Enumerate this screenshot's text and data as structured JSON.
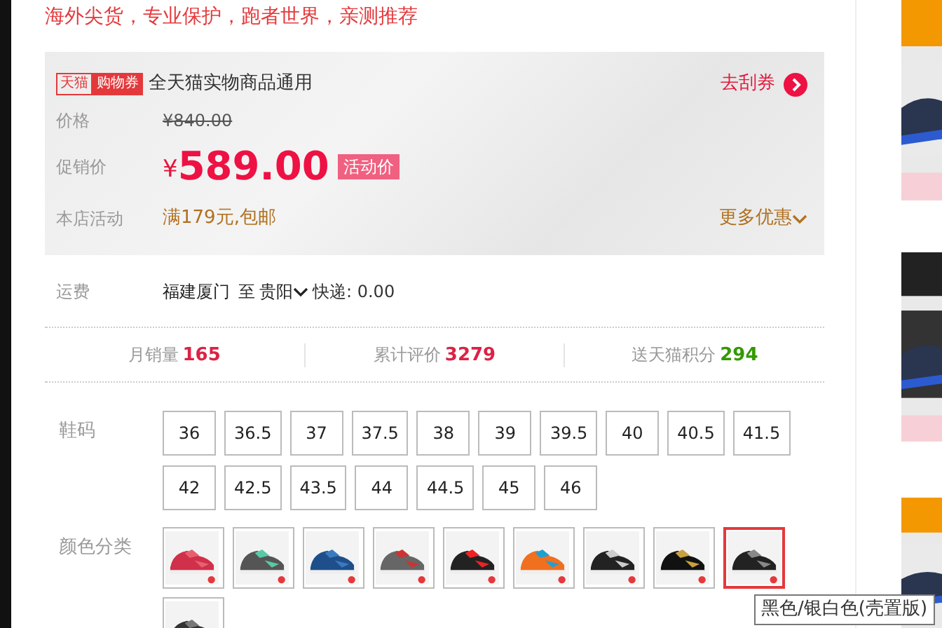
{
  "slogan": "海外尖货，专业保护，跑者世界，亲测推荐",
  "coupon": {
    "brand_tag": "天猫",
    "tag": "购物券",
    "text": "全天猫实物商品通用",
    "link": "去刮券"
  },
  "price": {
    "label": "价格",
    "original": "¥840.00"
  },
  "promo": {
    "label": "促销价",
    "currency": "¥",
    "amount": "589.00",
    "badge": "活动价"
  },
  "activity": {
    "label": "本店活动",
    "text": "满179元,包邮",
    "more": "更多优惠"
  },
  "shipping": {
    "label": "运费",
    "from": "福建厦门",
    "to_word": "至",
    "to": "贵阳",
    "method": "快递: 0.00"
  },
  "stats": [
    {
      "label": "月销量",
      "value": "165",
      "color": "#dd2244"
    },
    {
      "label": "累计评价",
      "value": "3279",
      "color": "#dd2244"
    },
    {
      "label": "送天猫积分",
      "value": "294",
      "color": "#339900"
    }
  ],
  "sizes": {
    "label": "鞋码",
    "items": [
      {
        "label": "36",
        "selected": false
      },
      {
        "label": "36.5",
        "selected": false
      },
      {
        "label": "37",
        "selected": false
      },
      {
        "label": "37.5",
        "selected": false
      },
      {
        "label": "38",
        "selected": false
      },
      {
        "label": "39",
        "selected": false
      },
      {
        "label": "39.5",
        "selected": false
      },
      {
        "label": "40",
        "selected": false
      },
      {
        "label": "40.5",
        "selected": false
      },
      {
        "label": "41.5",
        "selected": false
      },
      {
        "label": "42",
        "selected": false
      },
      {
        "label": "42.5",
        "selected": false
      },
      {
        "label": "43.5",
        "selected": false
      },
      {
        "label": "44",
        "selected": false
      },
      {
        "label": "44.5",
        "selected": false
      },
      {
        "label": "45",
        "selected": false
      },
      {
        "label": "46",
        "selected": false
      }
    ]
  },
  "colors": {
    "label": "颜色分类",
    "items": [
      {
        "kind": "picture",
        "selected": false
      },
      {
        "kind": "picture",
        "selected": false
      },
      {
        "kind": "picture",
        "selected": false
      },
      {
        "kind": "picture",
        "selected": false
      },
      {
        "kind": "picture",
        "selected": false
      },
      {
        "kind": "picture",
        "selected": false
      },
      {
        "kind": "picture",
        "selected": false
      },
      {
        "kind": "picture",
        "selected": false
      },
      {
        "kind": "picture",
        "selected": true
      },
      {
        "kind": "picture",
        "selected": false
      }
    ]
  },
  "tooltip": "黑色/银白色(壳置版)",
  "side_thumbnails": [
    {
      "kind": "picture"
    },
    {
      "kind": "picture"
    },
    {
      "kind": "picture"
    }
  ]
}
